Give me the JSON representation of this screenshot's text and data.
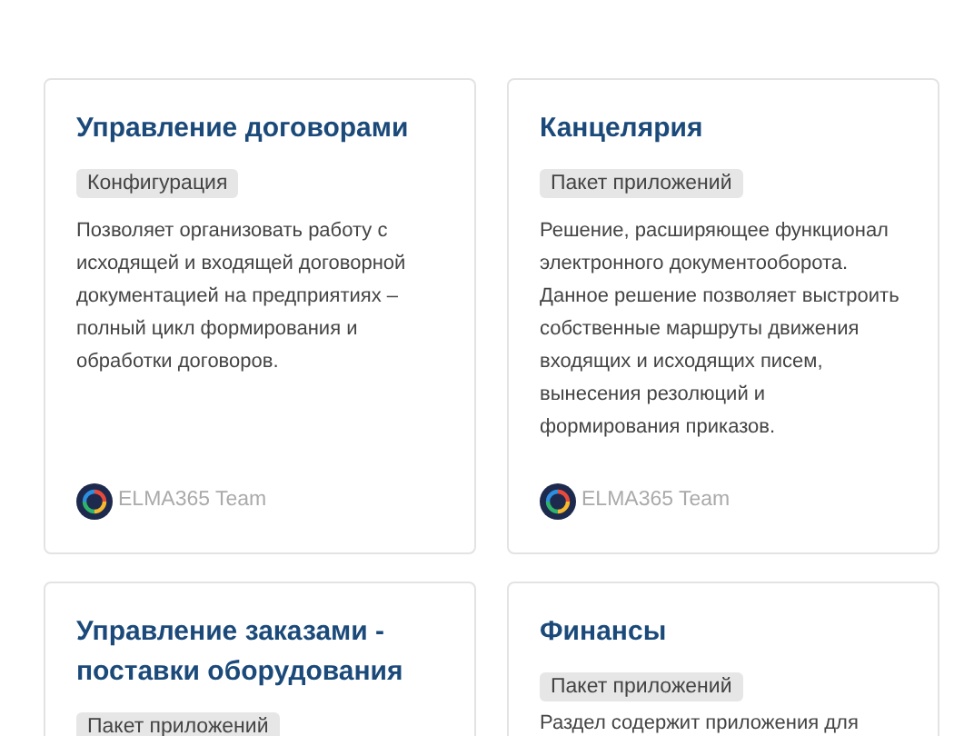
{
  "cards": [
    {
      "title": "Управление договорами",
      "tag": "Конфигурация",
      "description": "Позволяет организовать работу с исходящей и входящей договорной документацией на предприятиях – полный цикл формирования и обработки договоров.",
      "author": "ELMA365 Team"
    },
    {
      "title": "Канцелярия",
      "tag": "Пакет приложений",
      "description": "Решение, расширяющее функционал электронного документооборота. Данное решение позволяет выстроить собственные маршруты движения входящих и исходящих писем, вынесения резолюций и формирования приказов.",
      "author": "ELMA365 Team"
    },
    {
      "title": "Управление заказами - поставки оборудования",
      "tag": "Пакет приложений"
    },
    {
      "title": "Финансы",
      "tag": "Пакет приложений",
      "description": "Раздел содержит приложения для"
    }
  ]
}
